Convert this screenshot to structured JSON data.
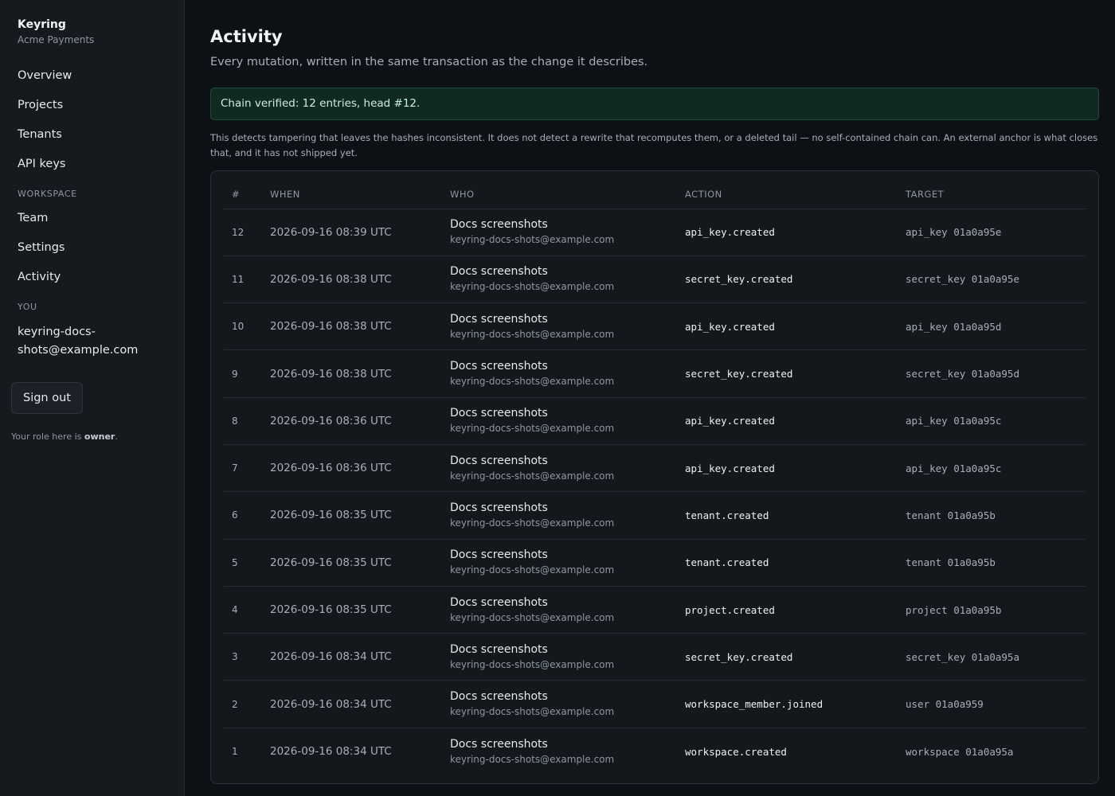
{
  "sidebar": {
    "app_name": "Keyring",
    "org_name": "Acme Payments",
    "nav": [
      {
        "label": "Overview"
      },
      {
        "label": "Projects"
      },
      {
        "label": "Tenants"
      },
      {
        "label": "API keys"
      }
    ],
    "workspace_section": "WORKSPACE",
    "workspace_nav": [
      {
        "label": "Team"
      },
      {
        "label": "Settings"
      },
      {
        "label": "Activity"
      }
    ],
    "you_section": "YOU",
    "user_email": "keyring-docs-shots@example.com",
    "signout_label": "Sign out",
    "role_prefix": "Your role here is ",
    "role_value": "owner",
    "role_suffix": "."
  },
  "main": {
    "title": "Activity",
    "subtitle": "Every mutation, written in the same transaction as the change it describes.",
    "verified_banner": "Chain verified: 12 entries, head #12.",
    "chain_note": "This detects tampering that leaves the hashes inconsistent. It does not detect a rewrite that recomputes them, or a deleted tail — no self-contained chain can. An external anchor is what closes that, and it has not shipped yet.",
    "columns": [
      "#",
      "WHEN",
      "WHO",
      "ACTION",
      "TARGET"
    ],
    "rows": [
      {
        "num": "12",
        "when": "2026-09-16 08:39 UTC",
        "who_name": "Docs screenshots",
        "who_email": "keyring-docs-shots@example.com",
        "action": "api_key.created",
        "target": "api_key 01a0a95e"
      },
      {
        "num": "11",
        "when": "2026-09-16 08:38 UTC",
        "who_name": "Docs screenshots",
        "who_email": "keyring-docs-shots@example.com",
        "action": "secret_key.created",
        "target": "secret_key 01a0a95e"
      },
      {
        "num": "10",
        "when": "2026-09-16 08:38 UTC",
        "who_name": "Docs screenshots",
        "who_email": "keyring-docs-shots@example.com",
        "action": "api_key.created",
        "target": "api_key 01a0a95d"
      },
      {
        "num": "9",
        "when": "2026-09-16 08:38 UTC",
        "who_name": "Docs screenshots",
        "who_email": "keyring-docs-shots@example.com",
        "action": "secret_key.created",
        "target": "secret_key 01a0a95d"
      },
      {
        "num": "8",
        "when": "2026-09-16 08:36 UTC",
        "who_name": "Docs screenshots",
        "who_email": "keyring-docs-shots@example.com",
        "action": "api_key.created",
        "target": "api_key 01a0a95c"
      },
      {
        "num": "7",
        "when": "2026-09-16 08:36 UTC",
        "who_name": "Docs screenshots",
        "who_email": "keyring-docs-shots@example.com",
        "action": "api_key.created",
        "target": "api_key 01a0a95c"
      },
      {
        "num": "6",
        "when": "2026-09-16 08:35 UTC",
        "who_name": "Docs screenshots",
        "who_email": "keyring-docs-shots@example.com",
        "action": "tenant.created",
        "target": "tenant 01a0a95b"
      },
      {
        "num": "5",
        "when": "2026-09-16 08:35 UTC",
        "who_name": "Docs screenshots",
        "who_email": "keyring-docs-shots@example.com",
        "action": "tenant.created",
        "target": "tenant 01a0a95b"
      },
      {
        "num": "4",
        "when": "2026-09-16 08:35 UTC",
        "who_name": "Docs screenshots",
        "who_email": "keyring-docs-shots@example.com",
        "action": "project.created",
        "target": "project 01a0a95b"
      },
      {
        "num": "3",
        "when": "2026-09-16 08:34 UTC",
        "who_name": "Docs screenshots",
        "who_email": "keyring-docs-shots@example.com",
        "action": "secret_key.created",
        "target": "secret_key 01a0a95a"
      },
      {
        "num": "2",
        "when": "2026-09-16 08:34 UTC",
        "who_name": "Docs screenshots",
        "who_email": "keyring-docs-shots@example.com",
        "action": "workspace_member.joined",
        "target": "user 01a0a959"
      },
      {
        "num": "1",
        "when": "2026-09-16 08:34 UTC",
        "who_name": "Docs screenshots",
        "who_email": "keyring-docs-shots@example.com",
        "action": "workspace.created",
        "target": "workspace 01a0a95a"
      }
    ]
  }
}
